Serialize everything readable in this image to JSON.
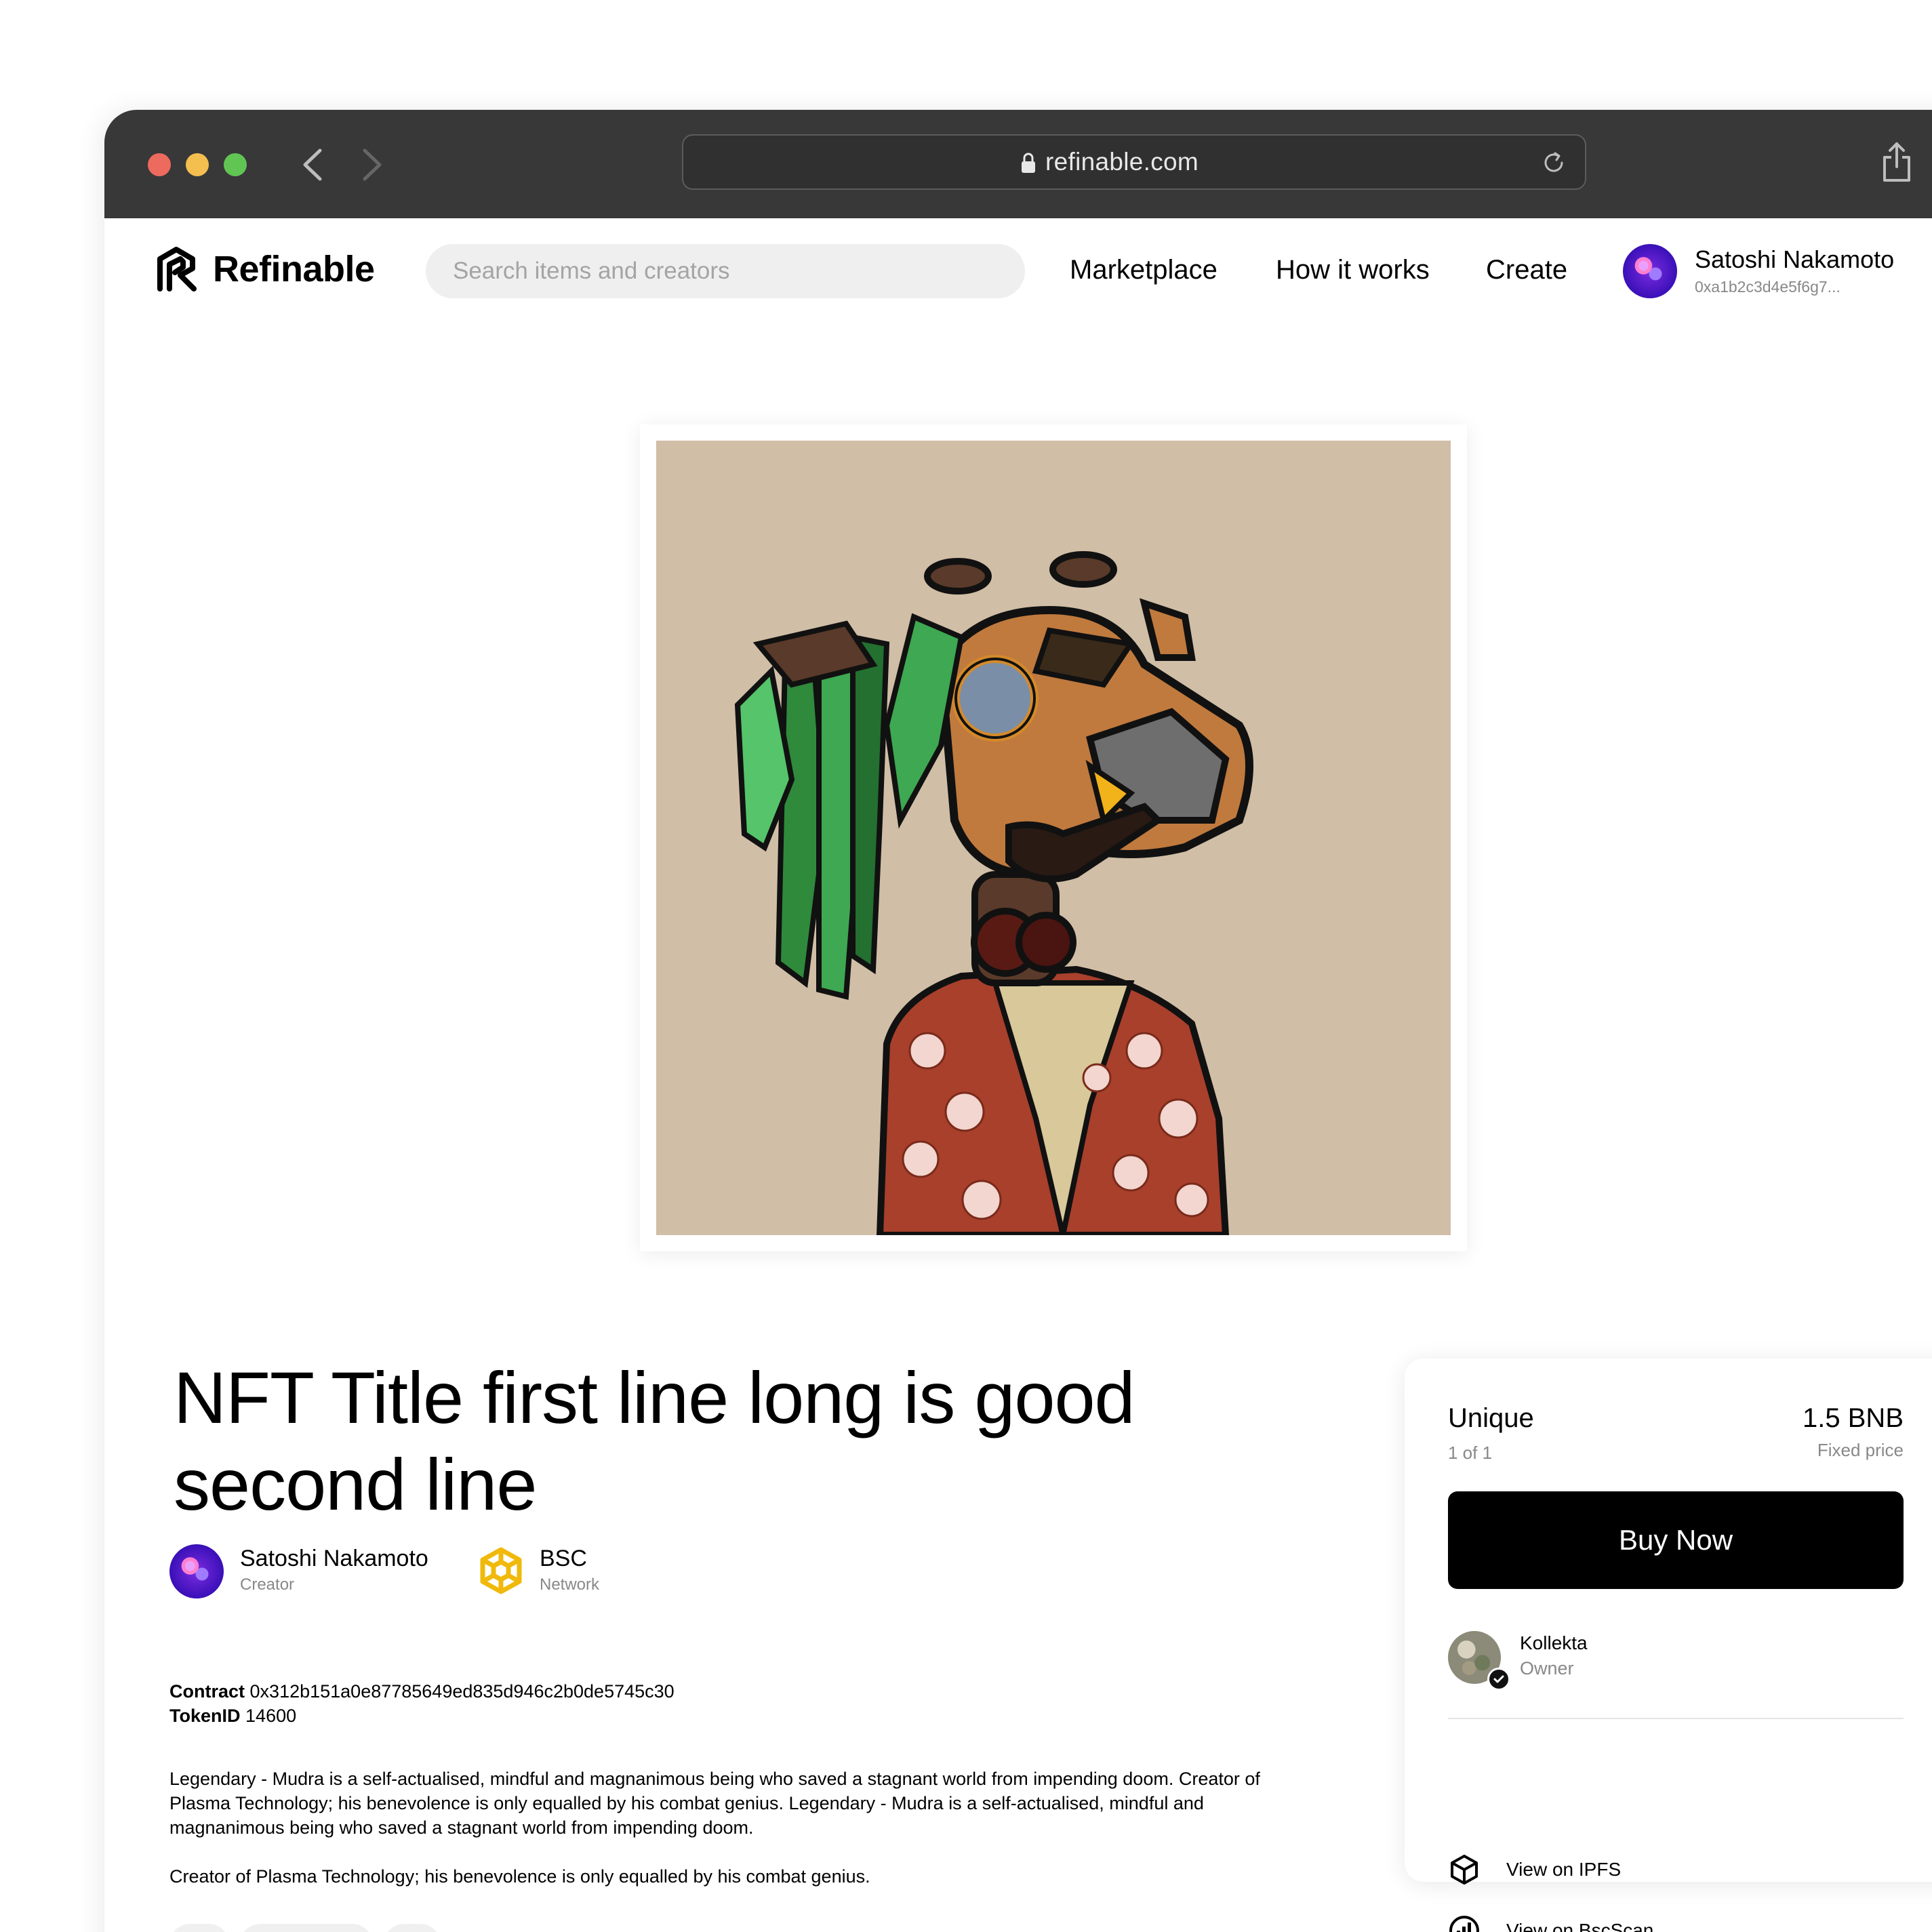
{
  "browser": {
    "url": "refinable.com"
  },
  "header": {
    "logo_text": "Refinable",
    "search_placeholder": "Search items and creators",
    "nav": {
      "marketplace": "Marketplace",
      "how_it_works": "How it works",
      "create": "Create"
    },
    "user": {
      "name": "Satoshi Nakamoto",
      "address": "0xa1b2c3d4e5f6g7..."
    }
  },
  "nft": {
    "title": "NFT Title first line long is good second line",
    "creator": {
      "name": "Satoshi Nakamoto",
      "role": "Creator"
    },
    "network": {
      "name": "BSC",
      "role": "Network"
    },
    "contract_label": "Contract",
    "contract_value": "0x312b151a0e87785649ed835d946c2b0de5745c30",
    "token_label": "TokenID",
    "token_value": "14600",
    "description_1": "Legendary - Mudra is a self-actualised, mindful and magnanimous being who saved a stagnant world from impending doom. Creator of Plasma Technology; his benevolence is only equalled by his combat genius. Legendary - Mudra is a self-actualised, mindful and magnanimous being who saved a stagnant world from impending doom.",
    "description_2": "Creator of Plasma Technology; his benevolence is only equalled by his combat genius."
  },
  "sale_card": {
    "edition": "Unique",
    "edition_count": "1 of 1",
    "price": "1.5 BNB",
    "price_type": "Fixed price",
    "buy_label": "Buy Now",
    "owner": {
      "name": "Kollekta",
      "role": "Owner"
    },
    "links": {
      "ipfs": "View on IPFS",
      "bscscan": "View on BscScan"
    }
  },
  "colors": {
    "chrome": "#383838",
    "art_background": "#d0bea6",
    "bsc_yellow": "#f0b90b",
    "button": "#000000"
  }
}
